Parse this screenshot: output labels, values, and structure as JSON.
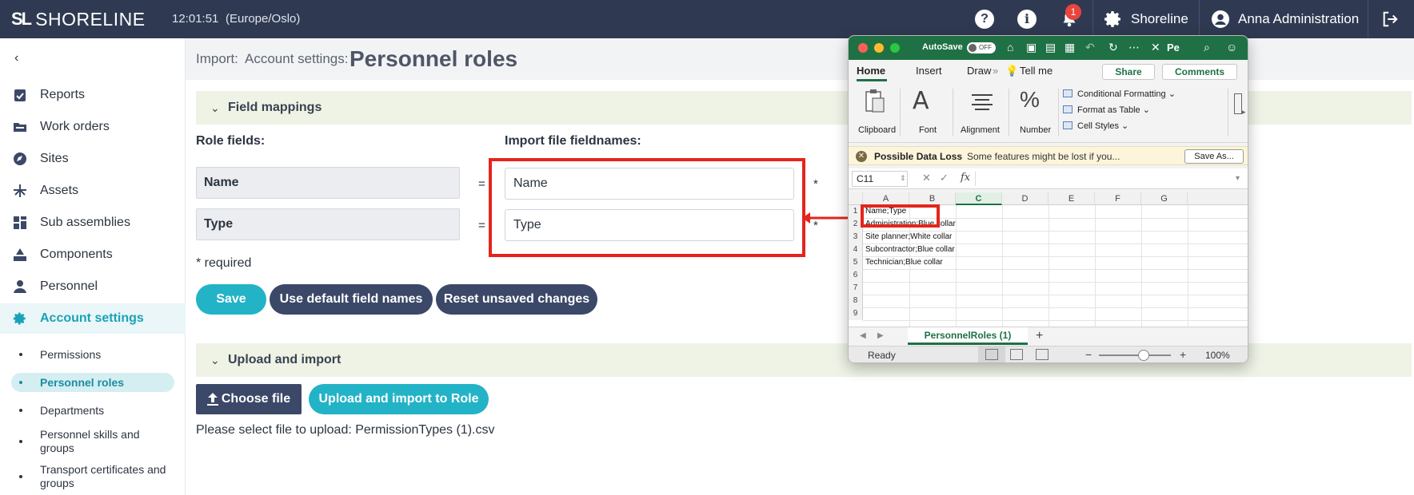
{
  "topbar": {
    "logo_mark": "SL",
    "logo_text": "SHORELINE",
    "time": "12:01:51",
    "timezone": "(Europe/Oslo)",
    "notification_count": "1",
    "org_name": "Shoreline",
    "user_name": "Anna Administration"
  },
  "sidebar": {
    "back_glyph": "‹",
    "items": [
      {
        "label": "Reports",
        "icon": "reports-check-icon"
      },
      {
        "label": "Work orders",
        "icon": "folder-icon"
      },
      {
        "label": "Sites",
        "icon": "compass-icon"
      },
      {
        "label": "Assets",
        "icon": "crane-icon"
      },
      {
        "label": "Sub assemblies",
        "icon": "grid-blocks-icon"
      },
      {
        "label": "Components",
        "icon": "shapes-icon"
      },
      {
        "label": "Personnel",
        "icon": "person-icon"
      },
      {
        "label": "Account settings",
        "icon": "gear-icon"
      }
    ],
    "subitems": [
      {
        "label": "Permissions"
      },
      {
        "label": "Personnel roles"
      },
      {
        "label": "Departments"
      },
      {
        "label": "Personnel skills and groups"
      },
      {
        "label": "Transport certificates and groups"
      }
    ]
  },
  "header": {
    "crumb_1": "Import:",
    "crumb_2": "Account settings:",
    "title": "Personnel roles"
  },
  "field_mappings": {
    "section_label": "Field mappings",
    "role_fields_header": "Role fields:",
    "import_fields_header": "Import file fieldnames:",
    "rows": [
      {
        "role": "Name",
        "eq": "=",
        "value": "Name",
        "star": "*"
      },
      {
        "role": "Type",
        "eq": "=",
        "value": "Type",
        "star": "*"
      }
    ],
    "required_note": "* required",
    "save_label": "Save",
    "default_label": "Use default field names",
    "reset_label": "Reset unsaved changes"
  },
  "upload": {
    "section_label": "Upload and import",
    "choose_label": "Choose file",
    "import_label": "Upload and import to Role",
    "hint": "Please select file to upload: PermissionTypes (1).csv"
  },
  "excel": {
    "autosave_label": "AutoSave",
    "autosave_state": "OFF",
    "doc_short": "Pe",
    "tabs": [
      "Home",
      "Insert",
      "Draw",
      "Tell me"
    ],
    "tabs_more": "»",
    "share_label": "Share",
    "comments_label": "Comments",
    "ribbon": {
      "clipboard": "Clipboard",
      "font": "Font",
      "font_glyph": "A",
      "alignment": "Alignment",
      "number": "Number",
      "number_glyph": "%",
      "styles": [
        "Conditional Formatting",
        "Format as Table",
        "Cell Styles"
      ]
    },
    "warning": {
      "title": "Possible Data Loss",
      "text": "Some features might be lost if you...",
      "button": "Save As..."
    },
    "name_box": "C11",
    "fx_label": "fx",
    "columns": [
      "A",
      "B",
      "C",
      "D",
      "E",
      "F",
      "G"
    ],
    "rows": [
      "1",
      "2",
      "3",
      "4",
      "5",
      "6",
      "7",
      "8",
      "9"
    ],
    "cells": [
      "Name;Type",
      "Administration;Blue collar",
      "Site planner;White collar",
      "Subcontractor;Blue collar",
      "Technician;Blue collar"
    ],
    "sheet_tab": "PersonnelRoles (1)",
    "status": "Ready",
    "zoom": "100%"
  },
  "colors": {
    "topbar": "#2f3a52",
    "accent_teal": "#23b3c7",
    "button_navy": "#3b4868",
    "highlight_red": "#e4251c",
    "excel_green": "#1f7145"
  }
}
